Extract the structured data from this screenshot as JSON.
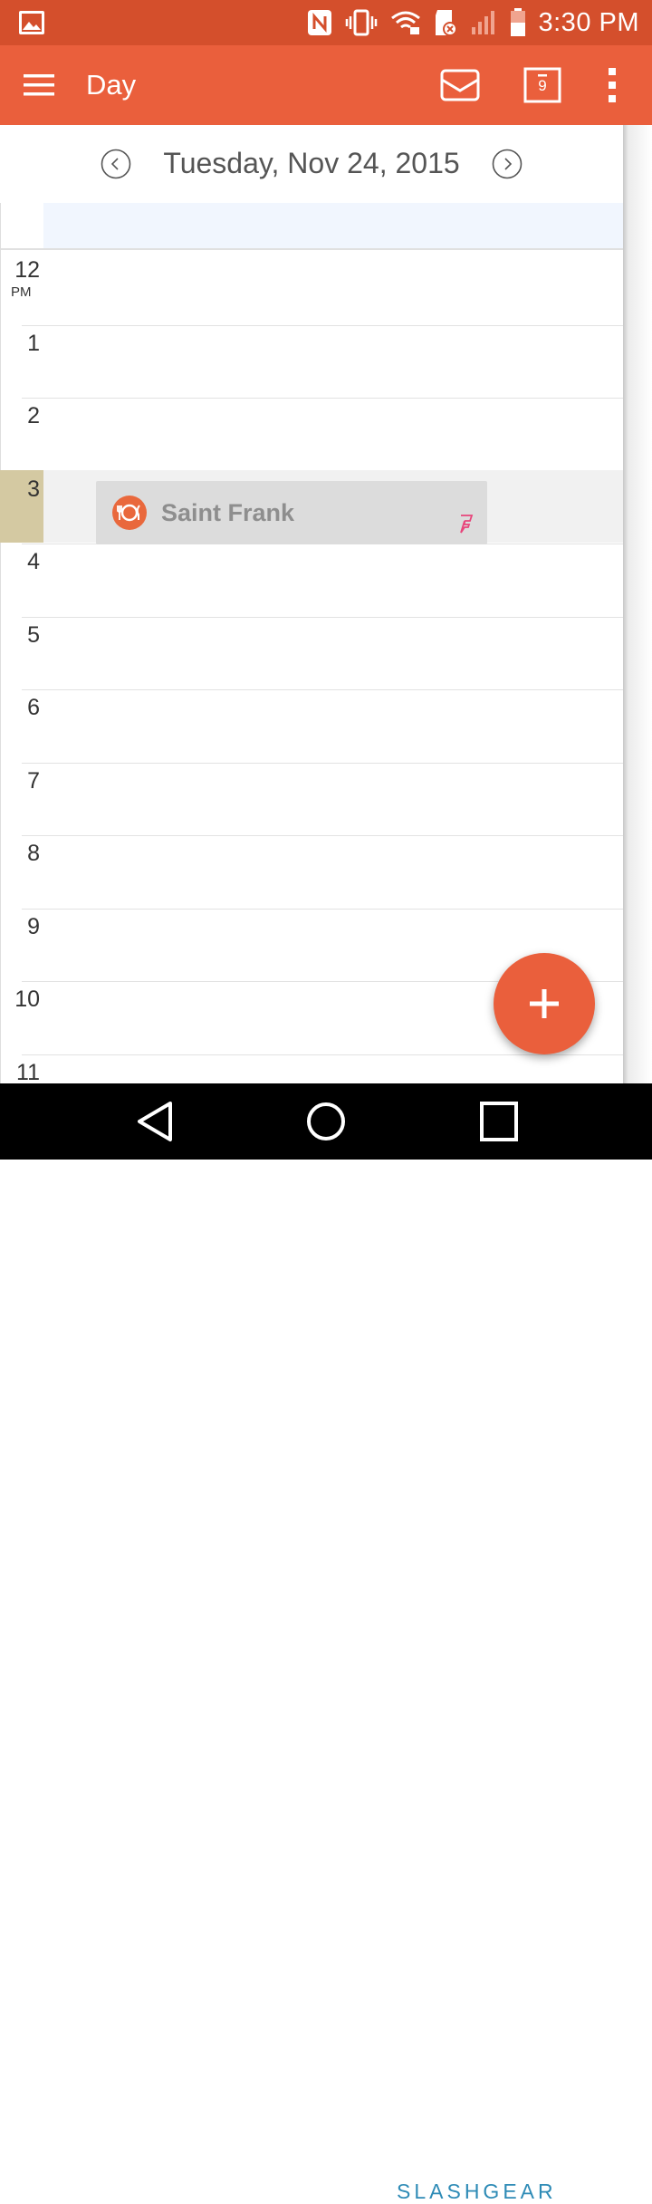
{
  "status_bar": {
    "time": "3:30 PM",
    "icons": [
      "gallery-icon",
      "nfc-icon",
      "vibrate-icon",
      "wifi-icon",
      "sd-card-icon",
      "signal-icon",
      "battery-icon"
    ]
  },
  "app_bar": {
    "title": "Day",
    "calendar_badge": "9",
    "icons": [
      "menu-icon",
      "inbox-icon",
      "today-calendar-icon",
      "more-vert-icon"
    ]
  },
  "date_nav": {
    "date": "Tuesday, Nov 24, 2015",
    "icons": [
      "chevron-left-icon",
      "chevron-right-icon"
    ]
  },
  "hours": [
    {
      "num": "12",
      "ampm": "PM"
    },
    {
      "num": "1",
      "ampm": ""
    },
    {
      "num": "2",
      "ampm": ""
    },
    {
      "num": "3",
      "ampm": ""
    },
    {
      "num": "4",
      "ampm": ""
    },
    {
      "num": "5",
      "ampm": ""
    },
    {
      "num": "6",
      "ampm": ""
    },
    {
      "num": "7",
      "ampm": ""
    },
    {
      "num": "8",
      "ampm": ""
    },
    {
      "num": "9",
      "ampm": ""
    },
    {
      "num": "10",
      "ampm": ""
    },
    {
      "num": "11",
      "ampm": ""
    }
  ],
  "event": {
    "title": "Saint Frank",
    "icon": "restaurant-icon",
    "source_icon": "foursquare-icon"
  },
  "fab": {
    "icon": "plus-icon"
  },
  "nav_bar": {
    "icons": [
      "back-icon",
      "home-icon",
      "recents-icon"
    ]
  },
  "watermark": "SLASHGEAR",
  "colors": {
    "accent": "#ea5f3c",
    "status_bar": "#d44f2c",
    "event_bg": "#dcdcdc",
    "now_marker": "#d4c9a2",
    "all_day": "#f1f6fe"
  }
}
